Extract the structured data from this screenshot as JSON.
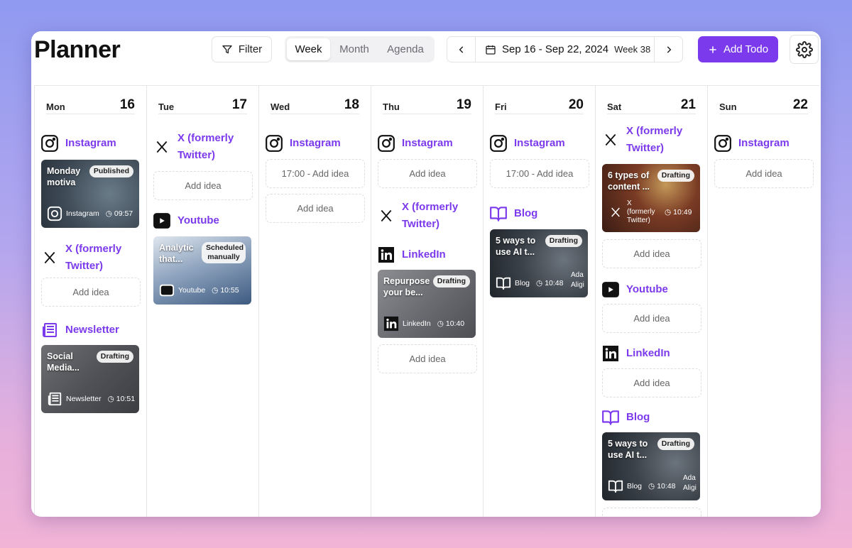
{
  "app": {
    "title": "Planner"
  },
  "toolbar": {
    "filter_label": "Filter",
    "views": [
      "Week",
      "Month",
      "Agenda"
    ],
    "active_view": "Week",
    "date_range": "Sep 16 - Sep 22, 2024",
    "week_label": "Week 38",
    "add_label": "Add Todo"
  },
  "colors": {
    "accent": "#7c3aed"
  },
  "days": [
    {
      "name": "Mon",
      "num": "16"
    },
    {
      "name": "Tue",
      "num": "17"
    },
    {
      "name": "Wed",
      "num": "18"
    },
    {
      "name": "Thu",
      "num": "19"
    },
    {
      "name": "Fri",
      "num": "20"
    },
    {
      "name": "Sat",
      "num": "21"
    },
    {
      "name": "Sun",
      "num": "22"
    }
  ],
  "channels": {
    "instagram": "Instagram",
    "x": "X (formerly Twitter)",
    "youtube": "Youtube",
    "newsletter": "Newsletter",
    "linkedin": "LinkedIn",
    "blog": "Blog"
  },
  "add_idea": "Add idea",
  "add_idea_timed": "17:00 - Add idea",
  "cards": {
    "mon_instagram": {
      "title": "Monday motiva",
      "status": "Published",
      "channel": "Instagram",
      "time": "09:57"
    },
    "mon_newsletter": {
      "title": "Social Media...",
      "status": "Drafting",
      "channel": "Newsletter",
      "time": "10:51"
    },
    "tue_youtube": {
      "title": "Analytic that...",
      "status": "Scheduled manually",
      "channel": "Youtube",
      "time": "10:55"
    },
    "thu_linkedin": {
      "title": "Repurpose your be...",
      "status": "Drafting",
      "channel": "LinkedIn",
      "time": "10:40"
    },
    "fri_blog": {
      "title": "5 ways to use AI t...",
      "status": "Drafting",
      "channel": "Blog",
      "time": "10:48",
      "extra": "Ada Aligi"
    },
    "sat_x": {
      "title": "6 types of content ...",
      "status": "Drafting",
      "channel": "X (formerly Twitter)",
      "time": "10:49"
    },
    "sat_blog": {
      "title": "5 ways to use AI t...",
      "status": "Drafting",
      "channel": "Blog",
      "time": "10:48",
      "extra": "Ada Aligi"
    }
  }
}
